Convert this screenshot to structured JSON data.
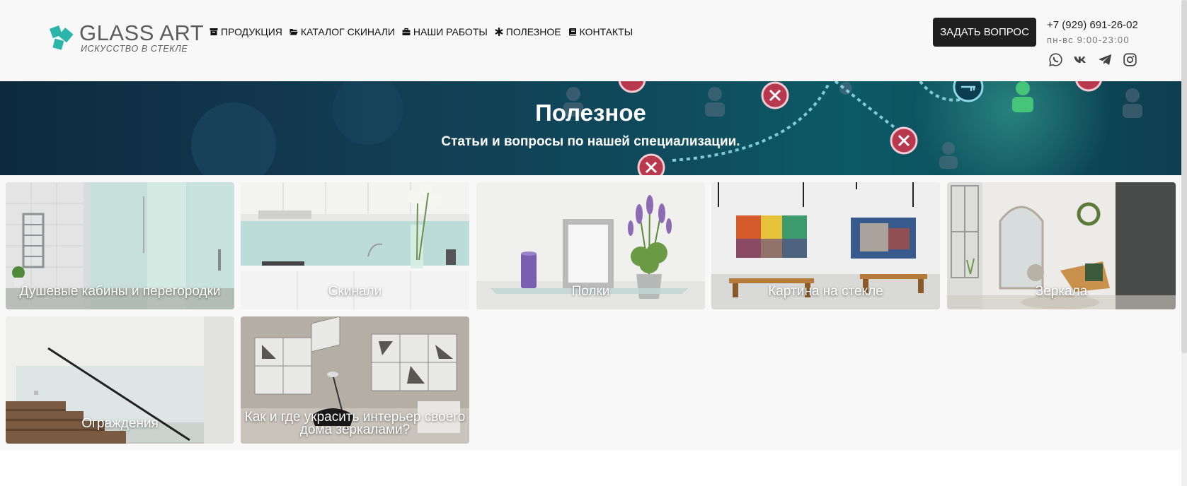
{
  "header": {
    "logo": {
      "name": "GLASS ART",
      "tagline": "ИСКУССТВО В СТЕКЛЕ"
    },
    "nav": [
      {
        "label": "ПРОДУКЦИЯ",
        "icon": "archive-icon"
      },
      {
        "label": "КАТАЛОГ СКИНАЛИ",
        "icon": "folder-open-icon"
      },
      {
        "label": "НАШИ РАБОТЫ",
        "icon": "briefcase-icon"
      },
      {
        "label": "ПОЛЕЗНОЕ",
        "icon": "asterisk-icon"
      },
      {
        "label": "КОНТАКТЫ",
        "icon": "book-icon"
      }
    ],
    "ask_button": "ЗАДАТЬ ВОПРОС",
    "phone": "+7 (929) 691-26-02",
    "hours": "пн-вс 9:00-23:00",
    "socials": [
      "whatsapp-icon",
      "vk-icon",
      "telegram-icon",
      "instagram-icon"
    ]
  },
  "hero": {
    "title": "Полезное",
    "subtitle": "Статьи и вопросы по нашей специализации."
  },
  "cards": [
    {
      "label": "Душевые кабины и перегородки"
    },
    {
      "label": "Скинали"
    },
    {
      "label": "Полки"
    },
    {
      "label": "Картина на стекле"
    },
    {
      "label": "Зеркала"
    },
    {
      "label": "Ограждения"
    },
    {
      "label": "Как и где украсить интерьер своего дома зеркалами?"
    }
  ],
  "colors": {
    "header_bg": "#f8f8f8",
    "button_bg": "#1f1f1f",
    "logo_accent": "#2bb5a8",
    "hero_bg": "#133b52"
  }
}
